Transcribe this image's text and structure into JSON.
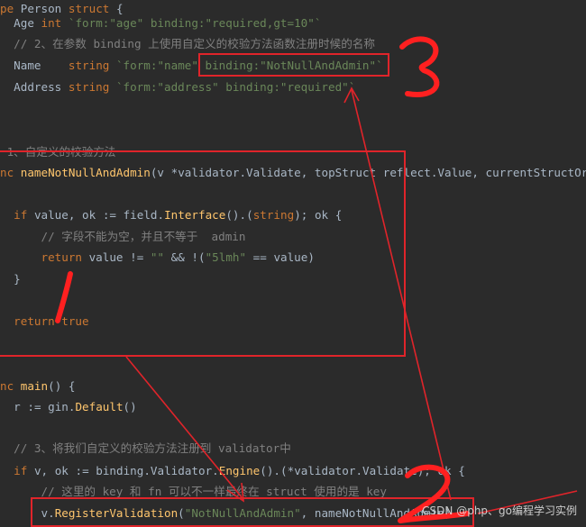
{
  "code_lines": [
    [
      {
        "t": "pe Person struct {",
        "c": "mixed_header"
      }
    ],
    [
      {
        "t": "  Age int `form:\"age\" binding:\"required,gt=10\"`",
        "c": "field"
      }
    ],
    [
      {
        "t": "  // 2、在参数 binding 上使用自定义的校验方法函数注册时候的名称",
        "c": "cmt"
      }
    ],
    [
      {
        "t": "  Name    string `form:\"name\" binding:\"NotNullAndAdmin\"`",
        "c": "field"
      }
    ],
    [
      {
        "t": "  Address string `form:\"address\" binding:\"required\"`",
        "c": "field"
      }
    ],
    [
      {
        "t": "",
        "c": "pl"
      }
    ],
    [
      {
        "t": "",
        "c": "pl"
      }
    ],
    [
      {
        "t": " 1、自定义的校验方法",
        "c": "cmt"
      }
    ],
    [
      {
        "t": "nc nameNotNullAndAdmin(v *validator.Validate, topStruct reflect.Value, currentStructOr",
        "c": "funcdecl"
      }
    ],
    [
      {
        "t": "",
        "c": "pl"
      }
    ],
    [
      {
        "t": "  if value, ok := field.Interface().(string); ok {",
        "c": "ifline"
      }
    ],
    [
      {
        "t": "      // 字段不能为空，并且不等于  admin",
        "c": "cmt"
      }
    ],
    [
      {
        "t": "      return value != \"\" && !(\"5lmh\" == value)",
        "c": "retline"
      }
    ],
    [
      {
        "t": "  }",
        "c": "pl"
      }
    ],
    [
      {
        "t": "",
        "c": "pl"
      }
    ],
    [
      {
        "t": "  return true",
        "c": "rettrue"
      }
    ],
    [
      {
        "t": "",
        "c": "pl"
      }
    ],
    [
      {
        "t": "",
        "c": "pl"
      }
    ],
    [
      {
        "t": "nc main() {",
        "c": "mainline"
      }
    ],
    [
      {
        "t": "  r := gin.Default()",
        "c": "ginline"
      }
    ],
    [
      {
        "t": "",
        "c": "pl"
      }
    ],
    [
      {
        "t": "  // 3、将我们自定义的校验方法注册到 validator中",
        "c": "cmt"
      }
    ],
    [
      {
        "t": "  if v, ok := binding.Validator.Engine().(*validator.Validate); ok {",
        "c": "engline"
      }
    ],
    [
      {
        "t": "      // 这里的 key 和 fn 可以不一样最终在 struct 使用的是 key",
        "c": "cmt"
      }
    ],
    [
      {
        "t": "      v.RegisterValidation(\"NotNullAndAdmin\", nameNotNullAndAdmin)",
        "c": "regline"
      }
    ]
  ],
  "annotations": {
    "numbers": [
      "3",
      "2"
    ],
    "watermark": "CSDN @php、go编程学习实例"
  },
  "colors": {
    "background": "#2b2b2b",
    "text": "#a9b7c6",
    "keyword": "#cc7832",
    "function": "#ffc66d",
    "string": "#6a8759",
    "comment": "#808080",
    "annotation_red": "#e0242a"
  }
}
